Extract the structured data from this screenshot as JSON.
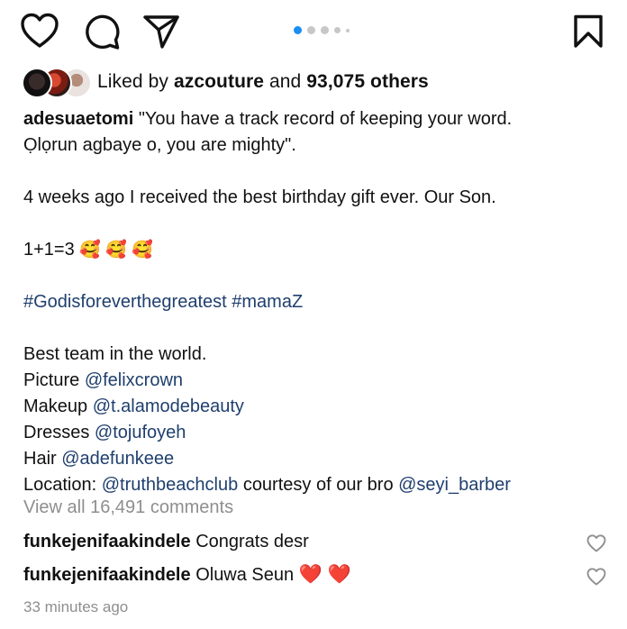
{
  "actions": {
    "like_icon": "heart-outline-icon",
    "comment_icon": "comment-bubble-icon",
    "share_icon": "paper-plane-icon",
    "save_icon": "bookmark-icon",
    "carousel_active_index": 0,
    "carousel_count": 5
  },
  "likes": {
    "prefix": "Liked by",
    "user": "azcouture",
    "connector": "and",
    "others": "93,075 others"
  },
  "caption": {
    "username": "adesuaetomi",
    "line1": "\"You have a track record of keeping your word.",
    "line2": "Ọlọrun agbaye o, you are mighty\".",
    "line3": "4 weeks ago I received the best birthday gift ever. Our Son.",
    "line4_text": "1+1=3",
    "line4_emoji": "🥰 🥰 🥰",
    "hashtag1": "#Godisforeverthegreatest",
    "hashtag2": "#mamaZ",
    "team_heading": "Best team in the world.",
    "credits": [
      {
        "label": "Picture",
        "handle": "@felixcrown"
      },
      {
        "label": "Makeup",
        "handle": "@t.alamodebeauty"
      },
      {
        "label": "Dresses",
        "handle": "@tojufoyeh"
      },
      {
        "label": "Hair",
        "handle": "@adefunkeee"
      }
    ],
    "location_label": "Location:",
    "location_handle": "@truthbeachclub",
    "location_mid": "courtesy of our bro",
    "location_bro": "@seyi_barber"
  },
  "view_all_comments": "View all 16,491 comments",
  "comments": [
    {
      "user": "funkejenifaakindele",
      "text": "Congrats desr",
      "emoji": ""
    },
    {
      "user": "funkejenifaakindele",
      "text": "Oluwa Seun",
      "emoji": "❤️ ❤️"
    }
  ],
  "timestamp": "33 minutes ago",
  "colors": {
    "link": "#1f3f6e",
    "muted": "#8e8e8e",
    "carousel_active": "#1a8ef3"
  }
}
